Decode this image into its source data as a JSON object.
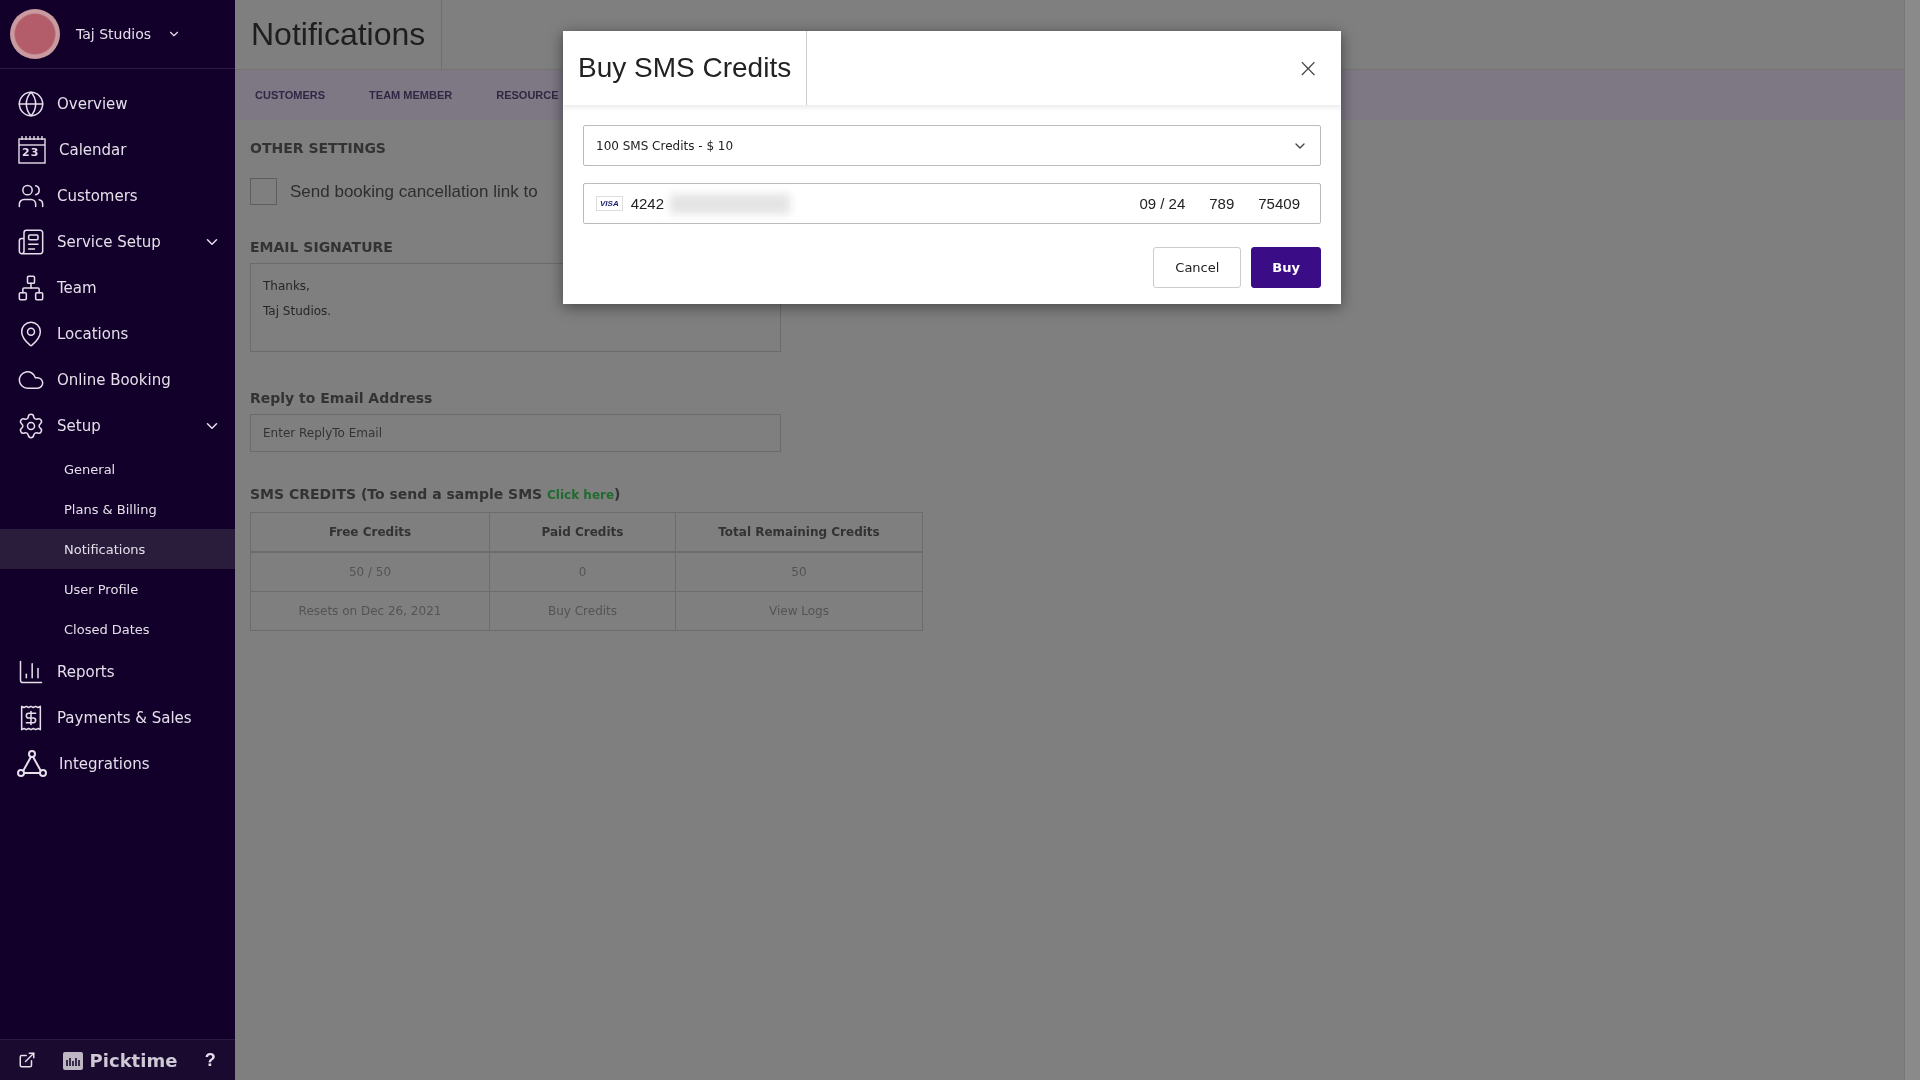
{
  "sidebar": {
    "account": {
      "name": "Taj Studios"
    },
    "items": [
      {
        "label": "Overview",
        "selected": false
      },
      {
        "label": "Calendar",
        "icon_text": "23",
        "selected": false
      },
      {
        "label": "Customers",
        "selected": false
      },
      {
        "label": "Service Setup",
        "collapsible": true,
        "selected": false
      },
      {
        "label": "Team",
        "selected": false
      },
      {
        "label": "Locations",
        "selected": false
      },
      {
        "label": "Online Booking",
        "selected": false
      },
      {
        "label": "Setup",
        "collapsible": true,
        "selected": false,
        "children": [
          {
            "label": "General",
            "selected": false
          },
          {
            "label": "Plans & Billing",
            "selected": false
          },
          {
            "label": "Notifications",
            "selected": true
          },
          {
            "label": "User Profile",
            "selected": false
          },
          {
            "label": "Closed Dates",
            "selected": false
          }
        ]
      },
      {
        "label": "Reports",
        "selected": false
      },
      {
        "label": "Payments & Sales",
        "selected": false
      },
      {
        "label": "Integrations",
        "selected": false
      }
    ],
    "footer": {
      "brand": "Picktime",
      "help": "?"
    }
  },
  "page": {
    "title": "Notifications",
    "tabs": [
      {
        "label": "CUSTOMERS"
      },
      {
        "label": "TEAM MEMBER"
      },
      {
        "label": "RESOURCE"
      }
    ],
    "other_settings": {
      "heading": "OTHER SETTINGS",
      "checkbox": {
        "label": "Send booking cancellation link to",
        "checked": false
      }
    },
    "email_signature": {
      "heading": "EMAIL SIGNATURE",
      "value": "Thanks,\nTaj Studios."
    },
    "reply_to": {
      "label": "Reply to Email Address",
      "placeholder": "Enter ReplyTo Email"
    },
    "sms_credits": {
      "heading": "SMS CREDITS (To send a sample SMS ",
      "link": "Click here",
      "heading_end": ")",
      "columns": [
        "Free Credits",
        "Paid Credits",
        "Total Remaining Credits"
      ],
      "rows": [
        [
          "50 / 50",
          "0",
          "50"
        ],
        [
          "Resets on Dec 26, 2021",
          "Buy Credits",
          "View Logs"
        ]
      ]
    }
  },
  "dialog": {
    "title": "Buy SMS Credits",
    "close": "×",
    "package": "100 SMS Credits - $ 10",
    "card": {
      "brand": "VISA",
      "number": "4242",
      "expiry": "09 / 24",
      "cvc": "789",
      "zip": "75409"
    },
    "buttons": [
      {
        "label": "Cancel",
        "kind": "secondary"
      },
      {
        "label": "Buy",
        "kind": "primary"
      }
    ]
  }
}
